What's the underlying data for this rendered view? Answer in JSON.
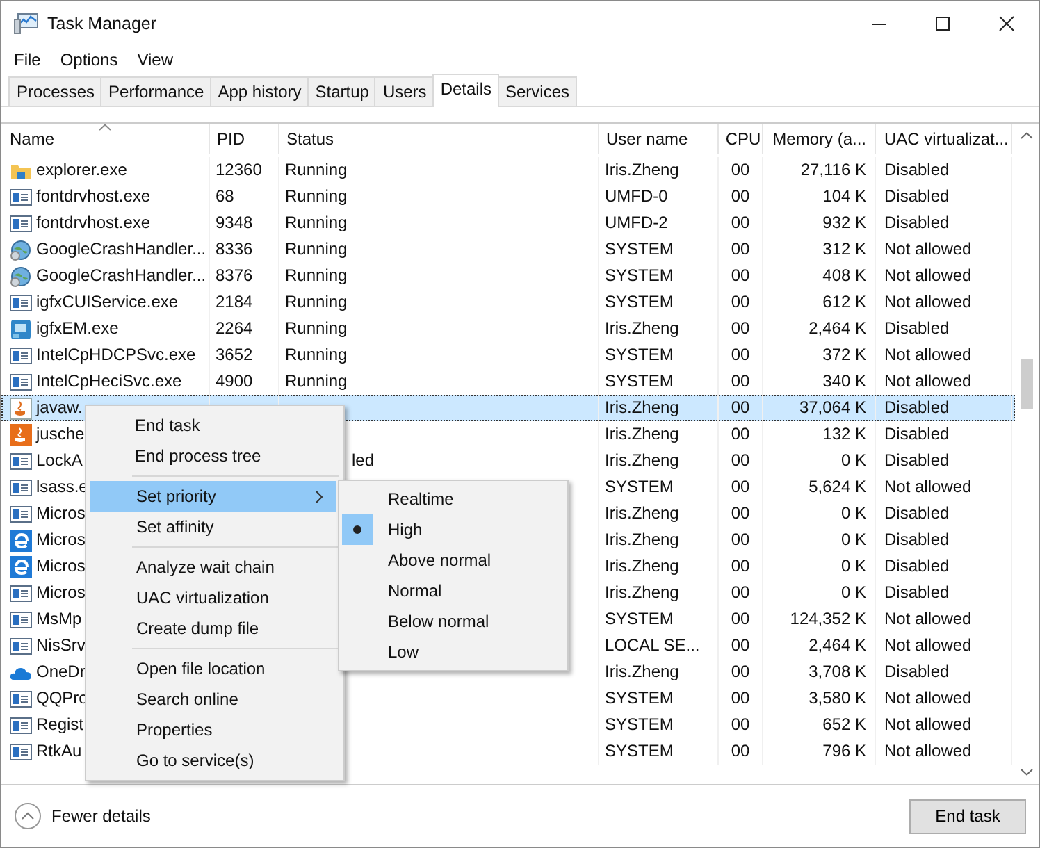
{
  "window": {
    "title": "Task Manager"
  },
  "menu_bar": [
    "File",
    "Options",
    "View"
  ],
  "tabs": [
    {
      "label": "Processes",
      "selected": false
    },
    {
      "label": "Performance",
      "selected": false
    },
    {
      "label": "App history",
      "selected": false
    },
    {
      "label": "Startup",
      "selected": false
    },
    {
      "label": "Users",
      "selected": false
    },
    {
      "label": "Details",
      "selected": true
    },
    {
      "label": "Services",
      "selected": false
    }
  ],
  "table": {
    "columns": [
      "Name",
      "PID",
      "Status",
      "User name",
      "CPU",
      "Memory (a...",
      "UAC virtualizat..."
    ],
    "rows": [
      {
        "kind": "folder",
        "name": "explorer.exe",
        "pid": "12360",
        "status": "Running",
        "user": "Iris.Zheng",
        "cpu": "00",
        "memory": "27,116 K",
        "uac": "Disabled",
        "selected": false
      },
      {
        "kind": "app",
        "name": "fontdrvhost.exe",
        "pid": "68",
        "status": "Running",
        "user": "UMFD-0",
        "cpu": "00",
        "memory": "104 K",
        "uac": "Disabled",
        "selected": false
      },
      {
        "kind": "app",
        "name": "fontdrvhost.exe",
        "pid": "9348",
        "status": "Running",
        "user": "UMFD-2",
        "cpu": "00",
        "memory": "932 K",
        "uac": "Disabled",
        "selected": false
      },
      {
        "kind": "globe",
        "name": "GoogleCrashHandler...",
        "pid": "8336",
        "status": "Running",
        "user": "SYSTEM",
        "cpu": "00",
        "memory": "312 K",
        "uac": "Not allowed",
        "selected": false
      },
      {
        "kind": "globe",
        "name": "GoogleCrashHandler...",
        "pid": "8376",
        "status": "Running",
        "user": "SYSTEM",
        "cpu": "00",
        "memory": "408 K",
        "uac": "Not allowed",
        "selected": false
      },
      {
        "kind": "app",
        "name": "igfxCUIService.exe",
        "pid": "2184",
        "status": "Running",
        "user": "SYSTEM",
        "cpu": "00",
        "memory": "612 K",
        "uac": "Not allowed",
        "selected": false
      },
      {
        "kind": "monitor",
        "name": "igfxEM.exe",
        "pid": "2264",
        "status": "Running",
        "user": "Iris.Zheng",
        "cpu": "00",
        "memory": "2,464 K",
        "uac": "Disabled",
        "selected": false
      },
      {
        "kind": "app",
        "name": "IntelCpHDCPSvc.exe",
        "pid": "3652",
        "status": "Running",
        "user": "SYSTEM",
        "cpu": "00",
        "memory": "372 K",
        "uac": "Not allowed",
        "selected": false
      },
      {
        "kind": "app",
        "name": "IntelCpHeciSvc.exe",
        "pid": "4900",
        "status": "Running",
        "user": "SYSTEM",
        "cpu": "00",
        "memory": "340 K",
        "uac": "Not allowed",
        "selected": false
      },
      {
        "kind": "cup",
        "name": "javaw.",
        "user": "Iris.Zheng",
        "cpu": "00",
        "memory": "37,064 K",
        "uac": "Disabled",
        "selected": true
      },
      {
        "kind": "cup-orange",
        "name": "jusche",
        "user": "Iris.Zheng",
        "cpu": "00",
        "memory": "132 K",
        "uac": "Disabled",
        "selected": false
      },
      {
        "kind": "app",
        "name": "LockA",
        "status": "led",
        "status_cut": true,
        "user": "Iris.Zheng",
        "cpu": "00",
        "memory": "0 K",
        "uac": "Disabled",
        "selected": false
      },
      {
        "kind": "app",
        "name": "lsass.e",
        "user": "SYSTEM",
        "cpu": "00",
        "memory": "5,624 K",
        "uac": "Not allowed",
        "selected": false
      },
      {
        "kind": "app",
        "name": "Micros",
        "user": "Iris.Zheng",
        "cpu": "00",
        "memory": "0 K",
        "uac": "Disabled",
        "selected": false
      },
      {
        "kind": "e",
        "name": "Micros",
        "user": "Iris.Zheng",
        "cpu": "00",
        "memory": "0 K",
        "uac": "Disabled",
        "selected": false
      },
      {
        "kind": "e",
        "name": "Micros",
        "user": "Iris.Zheng",
        "cpu": "00",
        "memory": "0 K",
        "uac": "Disabled",
        "selected": false
      },
      {
        "kind": "app",
        "name": "Micros",
        "user": "Iris.Zheng",
        "cpu": "00",
        "memory": "0 K",
        "uac": "Disabled",
        "selected": false
      },
      {
        "kind": "app",
        "name": "MsMp",
        "user": "SYSTEM",
        "cpu": "00",
        "memory": "124,352 K",
        "uac": "Not allowed",
        "selected": false
      },
      {
        "kind": "app",
        "name": "NisSrv",
        "user": "LOCAL SE...",
        "cpu": "00",
        "memory": "2,464 K",
        "uac": "Not allowed",
        "selected": false
      },
      {
        "kind": "cloud",
        "name": "OneDr",
        "user": "Iris.Zheng",
        "cpu": "00",
        "memory": "3,708 K",
        "uac": "Disabled",
        "selected": false
      },
      {
        "kind": "app",
        "name": "QQPro",
        "user": "SYSTEM",
        "cpu": "00",
        "memory": "3,580 K",
        "uac": "Not allowed",
        "selected": false
      },
      {
        "kind": "app",
        "name": "Regist",
        "user": "SYSTEM",
        "cpu": "00",
        "memory": "652 K",
        "uac": "Not allowed",
        "selected": false
      },
      {
        "kind": "app",
        "name": "RtkAu",
        "user": "SYSTEM",
        "cpu": "00",
        "memory": "796 K",
        "uac": "Not allowed",
        "selected": false
      }
    ]
  },
  "context_menu": {
    "groups": [
      {
        "items": [
          {
            "label": "End task",
            "selected": false,
            "submenu": false
          },
          {
            "label": "End process tree",
            "selected": false,
            "submenu": false
          }
        ]
      },
      {
        "items": [
          {
            "label": "Set priority",
            "selected": true,
            "submenu": true
          },
          {
            "label": "Set affinity",
            "selected": false,
            "submenu": false
          }
        ]
      },
      {
        "items": [
          {
            "label": "Analyze wait chain",
            "selected": false,
            "submenu": false
          },
          {
            "label": "UAC virtualization",
            "selected": false,
            "submenu": false
          },
          {
            "label": "Create dump file",
            "selected": false,
            "submenu": false
          }
        ]
      },
      {
        "items": [
          {
            "label": "Open file location",
            "selected": false,
            "submenu": false
          },
          {
            "label": "Search online",
            "selected": false,
            "submenu": false
          },
          {
            "label": "Properties",
            "selected": false,
            "submenu": false
          },
          {
            "label": "Go to service(s)",
            "selected": false,
            "submenu": false
          }
        ]
      }
    ]
  },
  "priority_menu": {
    "items": [
      {
        "label": "Realtime",
        "checked": false
      },
      {
        "label": "High",
        "checked": true
      },
      {
        "label": "Above normal",
        "checked": false
      },
      {
        "label": "Normal",
        "checked": false
      },
      {
        "label": "Below normal",
        "checked": false
      },
      {
        "label": "Low",
        "checked": false
      }
    ]
  },
  "footer": {
    "toggle": "Fewer details",
    "button": "End task"
  }
}
